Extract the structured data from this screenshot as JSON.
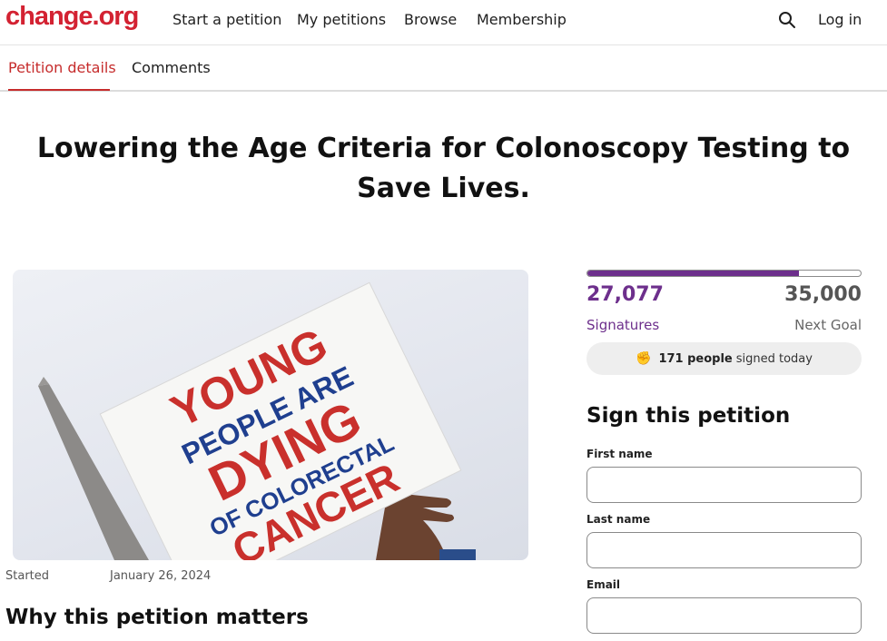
{
  "header": {
    "logo": "change.org",
    "nav": [
      "Start a petition",
      "My petitions",
      "Browse",
      "Membership"
    ],
    "login_label": "Log in",
    "search_icon": "search-icon"
  },
  "tabs": {
    "details": "Petition details",
    "comments": "Comments",
    "active": "details"
  },
  "petition": {
    "title": "Lowering the Age Criteria for Colonoscopy Testing to Save Lives.",
    "image_sign_text": [
      "YOUNG",
      "PEOPLE ARE",
      "DYING",
      "OF COLORECTAL",
      "CANCER"
    ],
    "started_label": "Started",
    "started_date": "January 26, 2024",
    "why_heading": "Why this petition matters"
  },
  "progress": {
    "signatures": "27,077",
    "signatures_label": "Signatures",
    "goal": "35,000",
    "goal_label": "Next Goal",
    "fraction": 0.7736,
    "today_count": "171 people",
    "today_text": "signed today",
    "today_icon": "fist-icon",
    "accent_color": "#6d2f8c"
  },
  "sign_form": {
    "heading": "Sign this petition",
    "first_name_label": "First name",
    "first_name_value": "",
    "last_name_label": "Last name",
    "last_name_value": "",
    "email_label": "Email",
    "email_value": ""
  },
  "colors": {
    "brand": "#d32232",
    "tab_active": "#c62c2c"
  }
}
